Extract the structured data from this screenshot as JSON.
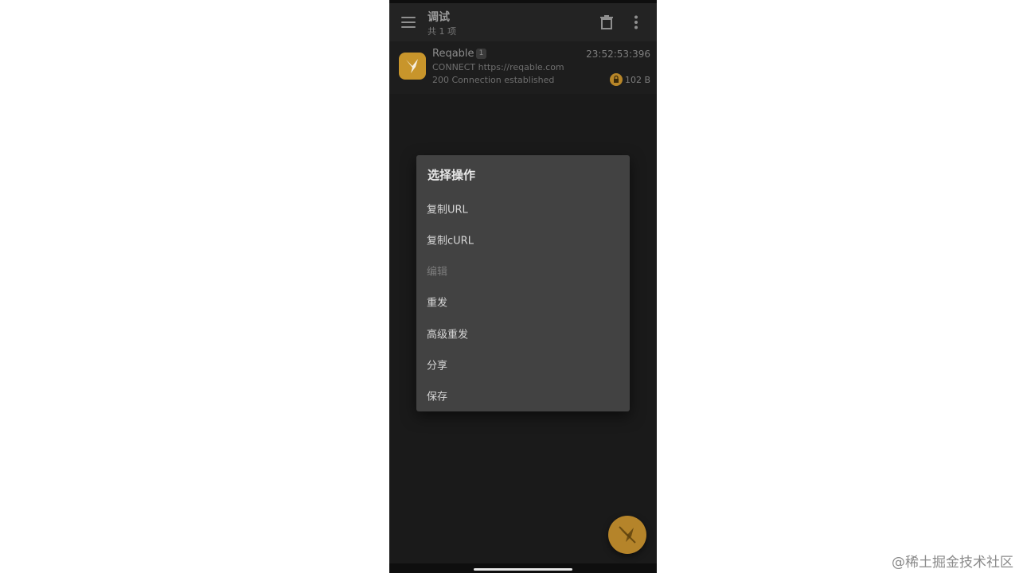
{
  "app_bar": {
    "title": "调试",
    "subtitle": "共 1 项",
    "menu_icon": "hamburger-menu-icon",
    "delete_icon": "trash-icon",
    "more_icon": "more-vertical-icon"
  },
  "list": {
    "items": [
      {
        "name": "Reqable",
        "badge": "1",
        "time": "23:52:53:396",
        "url": "CONNECT https://reqable.com",
        "status": "200 Connection established",
        "size": "102 B",
        "icon": "reqable-hummingbird-icon",
        "secure_icon": "lock-icon"
      }
    ]
  },
  "dialog": {
    "title": "选择操作",
    "items": [
      {
        "label": "复制URL",
        "enabled": true
      },
      {
        "label": "复制cURL",
        "enabled": true
      },
      {
        "label": "编辑",
        "enabled": false
      },
      {
        "label": "重发",
        "enabled": true
      },
      {
        "label": "高级重发",
        "enabled": true
      },
      {
        "label": "分享",
        "enabled": true
      },
      {
        "label": "保存",
        "enabled": true
      }
    ]
  },
  "fab": {
    "icon": "capture-off-bird-icon"
  },
  "watermark": "@稀土掘金技术社区",
  "colors": {
    "background": "#1a1a1a",
    "app_bar": "#232323",
    "dialog": "#424242",
    "accent": "#c8952b"
  }
}
